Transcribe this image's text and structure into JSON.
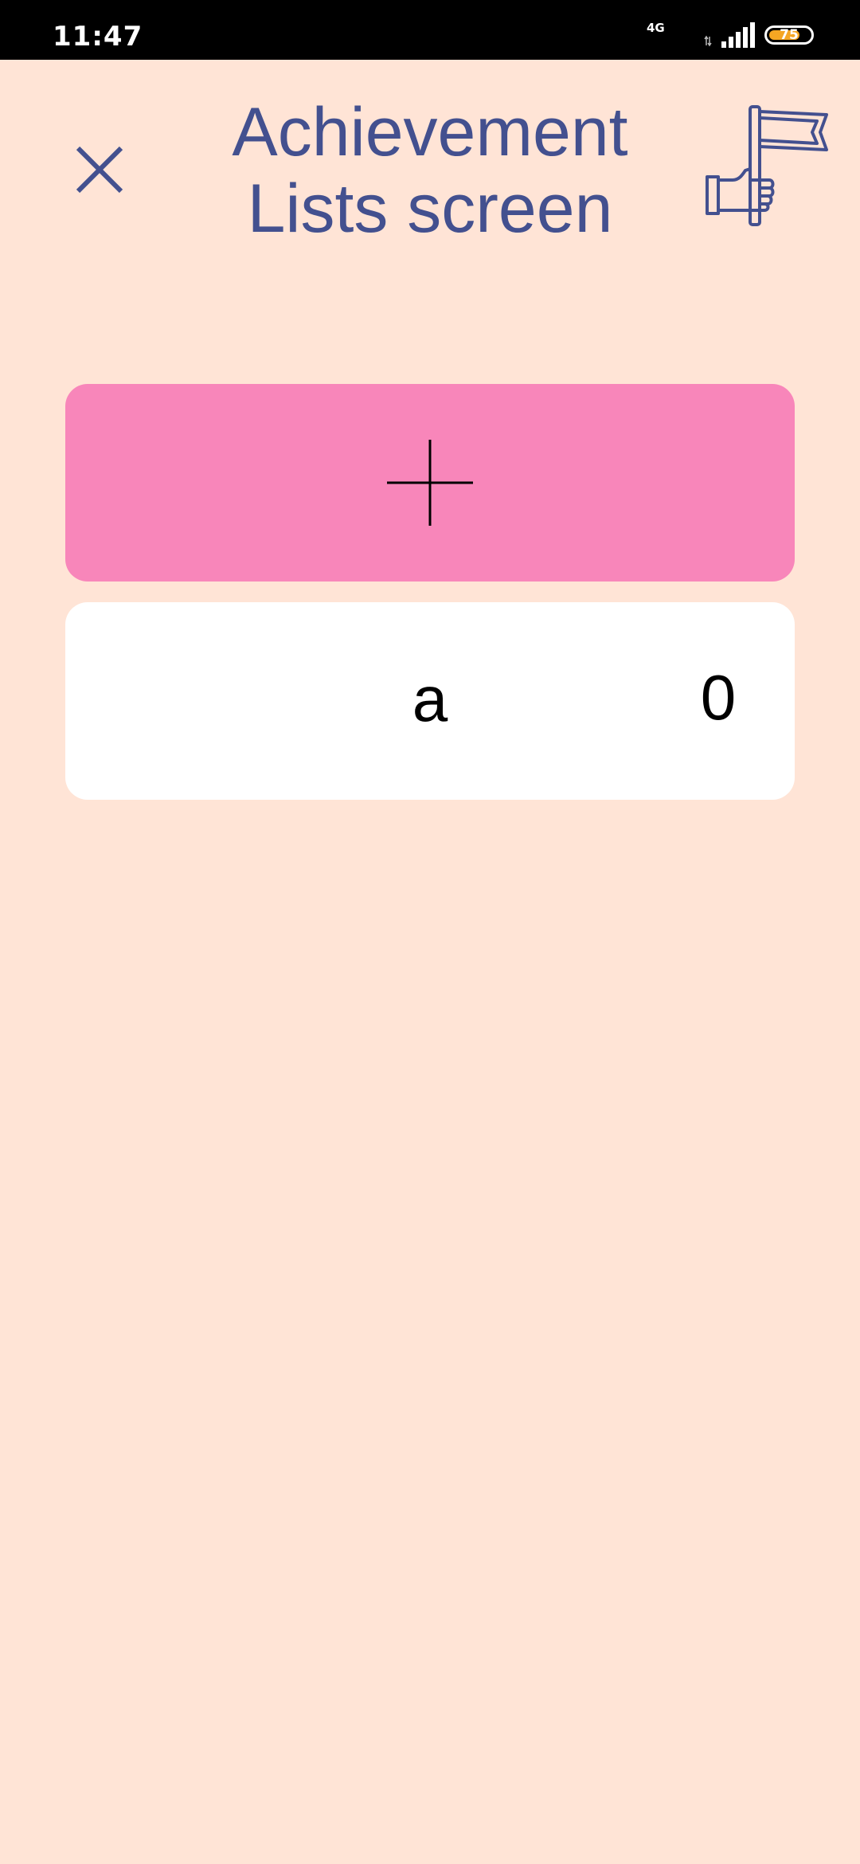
{
  "status_bar": {
    "time": "11:47",
    "network": "4G",
    "battery_percent": "75",
    "battery_level": 0.75,
    "battery_color": "#F5A623"
  },
  "header": {
    "title_line1": "Achievement",
    "title_line2": "Lists screen",
    "close_icon": "close-icon",
    "flag_icon": "hand-holding-flag-icon",
    "accent_color": "#43508F"
  },
  "add_button": {
    "icon": "plus-icon",
    "color": "#F886BA"
  },
  "lists": [
    {
      "name": "a",
      "count": "0"
    }
  ],
  "colors": {
    "background": "#FFE4D6",
    "card": "#FFFFFF"
  }
}
